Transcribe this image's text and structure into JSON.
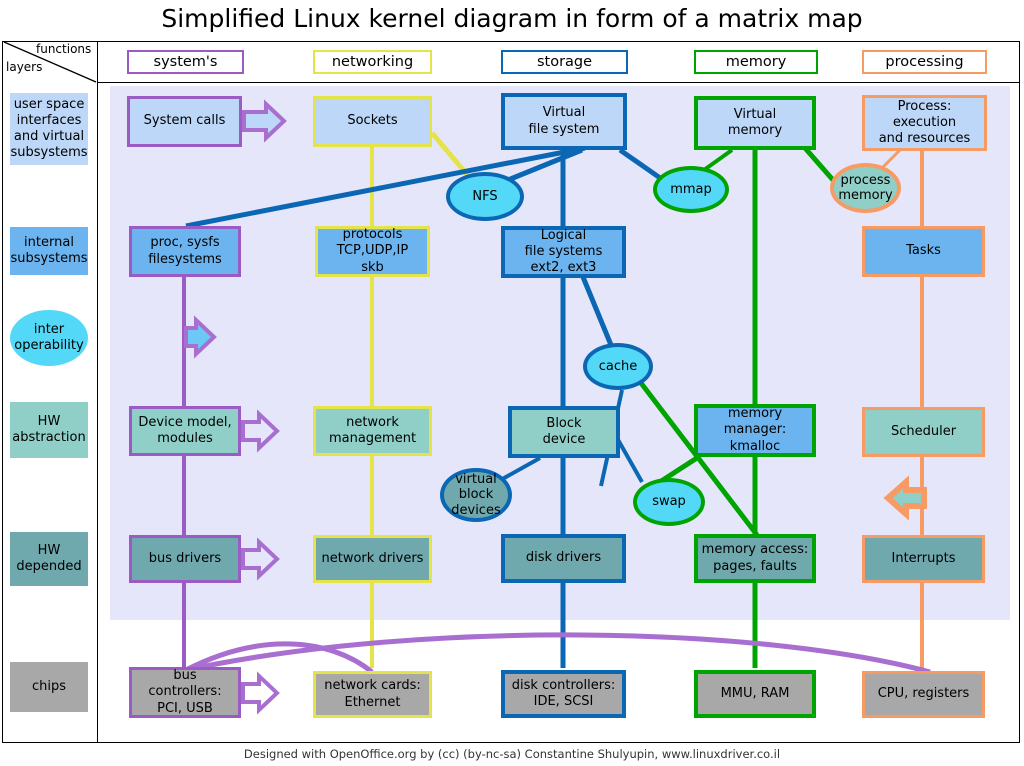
{
  "title": "Simplified Linux kernel diagram in form of a matrix map",
  "footer": "Designed with OpenOffice.org by (cc) (by-nc-sa) Constantine Shulyupin, www.linuxdriver.co.il",
  "corner": {
    "functions_label": "functions",
    "layers_label": "layers"
  },
  "colors": {
    "systems": "#9a5bc4",
    "networking": "#e4e44a",
    "storage": "#0b67b3",
    "memory": "#00a400",
    "processing": "#f79b६5",
    "processing_fix": "#f79b65",
    "fill_userspace": "#bcd7f7",
    "fill_internal": "#6cb4f0",
    "fill_interop": "#54d8f8",
    "fill_hwabs": "#8fcfc8",
    "fill_hwdep": "#6fa8ad",
    "fill_chips": "#a8a8a8",
    "matrix_bg": "#e6e6fa"
  },
  "columns": [
    {
      "id": "systems",
      "label": "system's",
      "color": "#9a5bc4"
    },
    {
      "id": "networking",
      "label": "networking",
      "color": "#e4e44a"
    },
    {
      "id": "storage",
      "label": "storage",
      "color": "#0b67b3"
    },
    {
      "id": "memory",
      "label": "memory",
      "color": "#00a400"
    },
    {
      "id": "processing",
      "label": "processing",
      "color": "#f79b65"
    }
  ],
  "layers": [
    {
      "id": "userspace",
      "label": "user space interfaces and virtual subsystems",
      "fill": "#bcd7f7",
      "shape": "rect"
    },
    {
      "id": "internal",
      "label": "internal subsystems",
      "fill": "#6cb4f0",
      "shape": "rect"
    },
    {
      "id": "interop",
      "label": "inter operability",
      "fill": "#54d8f8",
      "shape": "ellipse"
    },
    {
      "id": "hwabs",
      "label": "HW abstraction",
      "fill": "#8fcfc8",
      "shape": "rect"
    },
    {
      "id": "hwdep",
      "label": "HW depended",
      "fill": "#6fa8ad",
      "shape": "rect"
    },
    {
      "id": "chips",
      "label": "chips",
      "fill": "#a8a8a8",
      "shape": "rect"
    }
  ],
  "nodes": {
    "system_calls": "System calls",
    "sockets": "Sockets",
    "vfs": "Virtual file system",
    "virtual_memory": "Virtual memory",
    "process": "Process: execution and resources",
    "nfs": "NFS",
    "mmap": "mmap",
    "process_memory": "process memory",
    "proc_sysfs": "proc, sysfs filesystems",
    "protocols": "protocols TCP,UDP,IP skb",
    "logical_fs": "Logical file systems ext2, ext3",
    "tasks": "Tasks",
    "cache": "cache",
    "device_model": "Device model, modules",
    "network_mgmt": "network management",
    "block_device": "Block device",
    "memory_manager": "memory manager: kmalloc",
    "scheduler": "Scheduler",
    "virtual_block": "virtual block devices",
    "swap": "swap",
    "bus_drivers": "bus drivers",
    "network_drivers": "network drivers",
    "disk_drivers": "disk drivers",
    "memory_access": "memory access: pages, faults",
    "interrupts": "Interrupts",
    "bus_controllers": "bus controllers: PCI, USB",
    "network_cards": "network cards: Ethernet",
    "disk_controllers": "disk controllers: IDE, SCSI",
    "mmu_ram": "MMU, RAM",
    "cpu_registers": "CPU, registers"
  },
  "node_lines": {
    "system_calls": [
      "System calls"
    ],
    "sockets": [
      "Sockets"
    ],
    "vfs": [
      "Virtual",
      "file system"
    ],
    "virtual_memory": [
      "Virtual",
      "memory"
    ],
    "process": [
      "Process:",
      "execution",
      "and resources"
    ],
    "nfs": [
      "NFS"
    ],
    "mmap": [
      "mmap"
    ],
    "process_memory": [
      "process",
      "memory"
    ],
    "proc_sysfs": [
      "proc, sysfs",
      "filesystems"
    ],
    "protocols": [
      "protocols",
      "TCP,UDP,IP",
      "skb"
    ],
    "logical_fs": [
      "Logical",
      "file systems",
      "ext2, ext3"
    ],
    "tasks": [
      "Tasks"
    ],
    "cache": [
      "cache"
    ],
    "device_model": [
      "Device model,",
      "modules"
    ],
    "network_mgmt": [
      "network",
      "management"
    ],
    "block_device": [
      "Block",
      "device"
    ],
    "memory_manager": [
      "memory",
      "manager:",
      "kmalloc"
    ],
    "scheduler": [
      "Scheduler"
    ],
    "virtual_block": [
      "virtual",
      "block",
      "devices"
    ],
    "swap": [
      "swap"
    ],
    "bus_drivers": [
      "bus drivers"
    ],
    "network_drivers": [
      "network drivers"
    ],
    "disk_drivers": [
      "disk drivers"
    ],
    "memory_access": [
      "memory access:",
      "pages, faults"
    ],
    "interrupts": [
      "Interrupts"
    ],
    "bus_controllers": [
      "bus",
      "controllers:",
      "PCI, USB"
    ],
    "network_cards": [
      "network cards:",
      "Ethernet"
    ],
    "disk_controllers": [
      "disk controllers:",
      "IDE, SCSI"
    ],
    "mmu_ram": [
      "MMU, RAM"
    ],
    "cpu_registers": [
      "CPU, registers"
    ]
  }
}
